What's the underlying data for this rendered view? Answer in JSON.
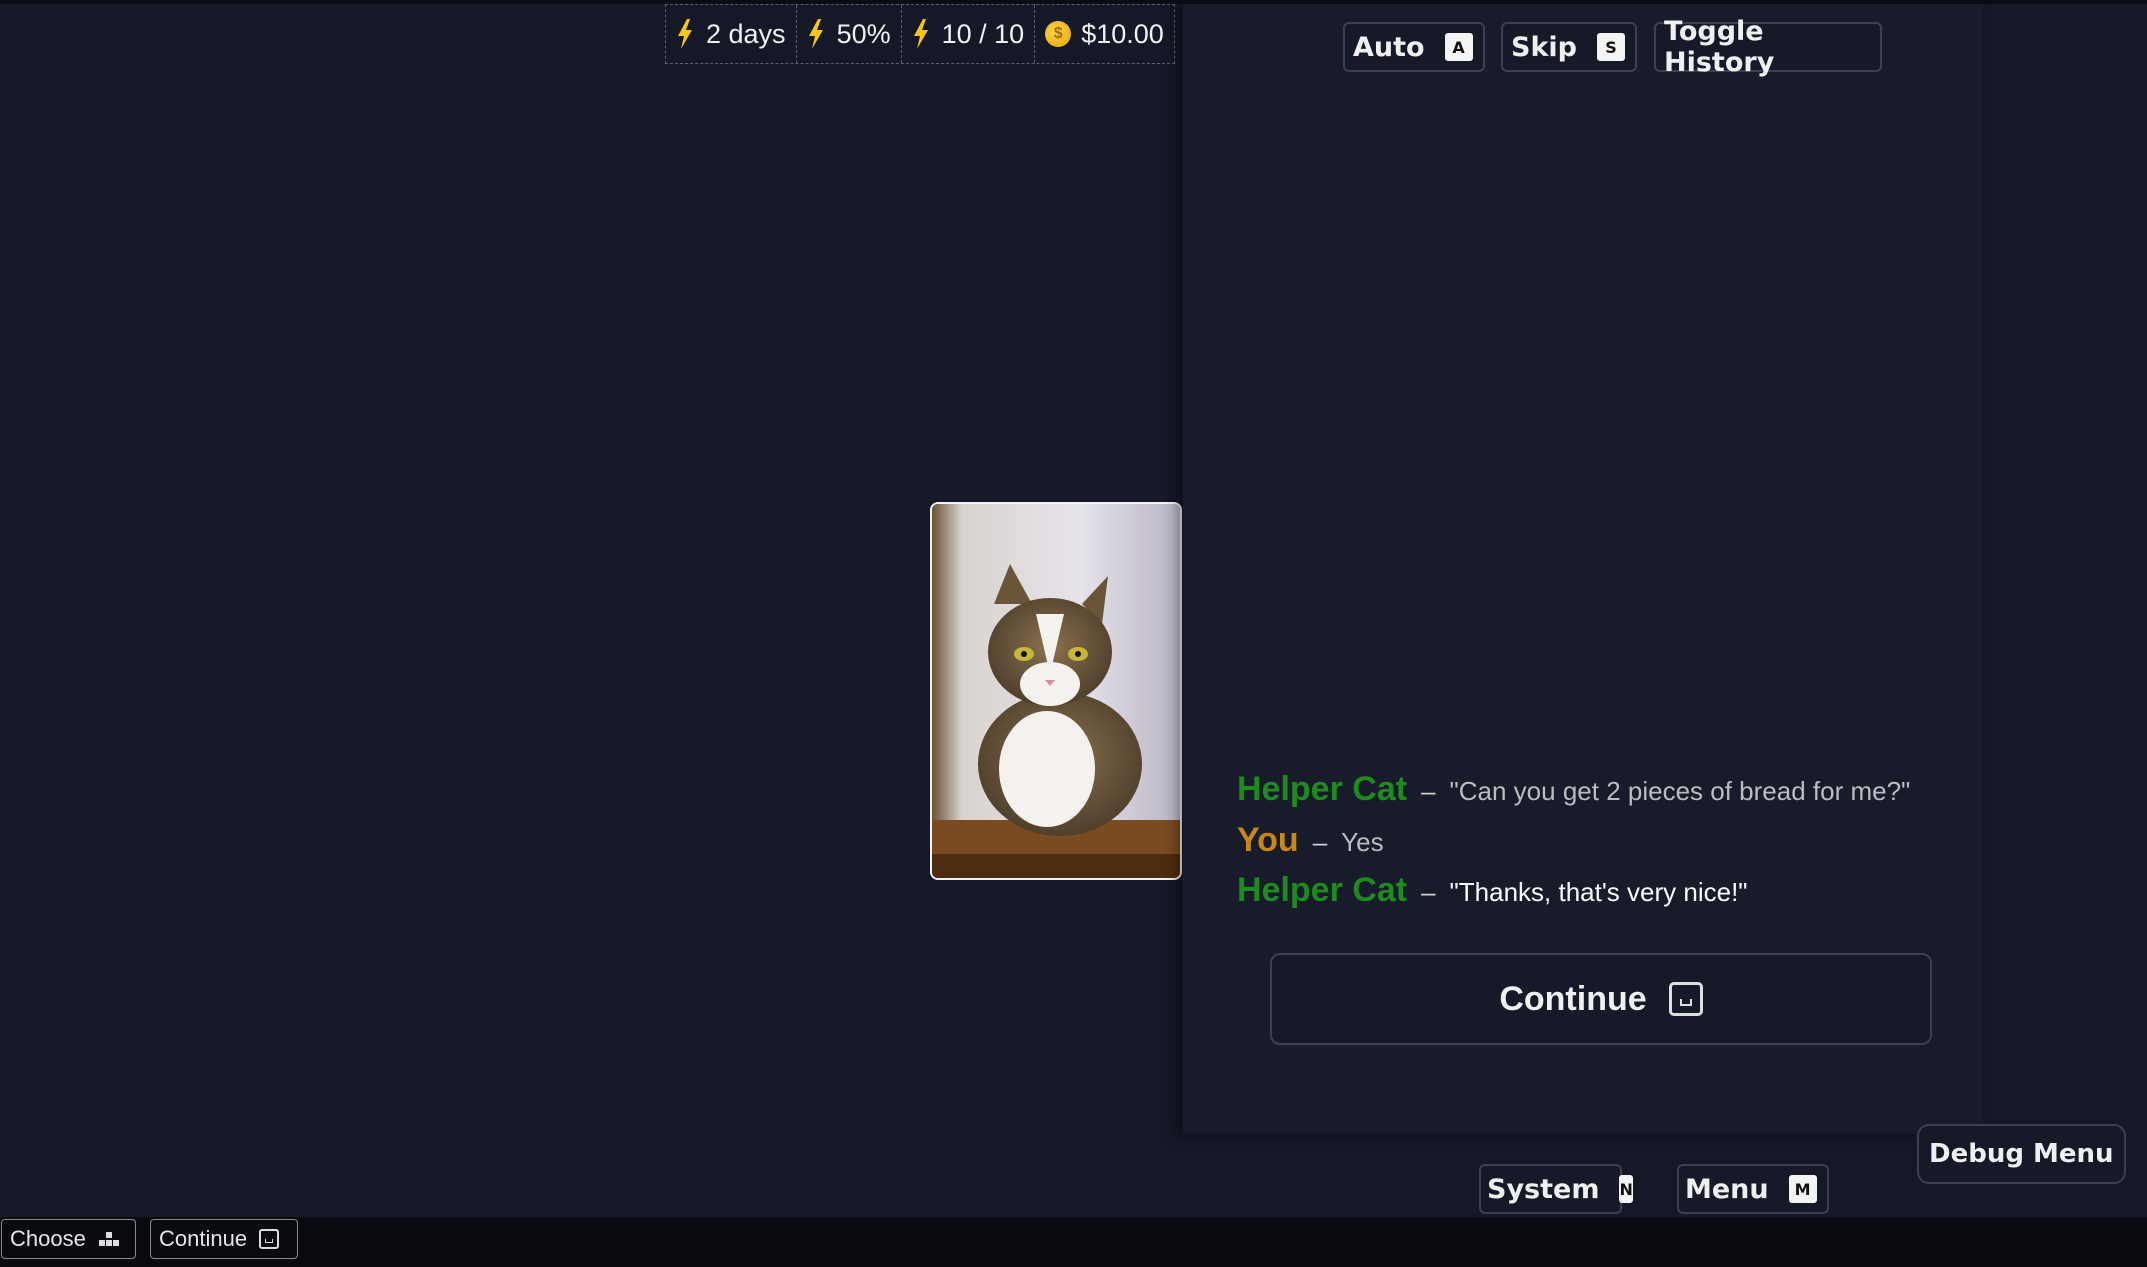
{
  "stats": {
    "days": "2 days",
    "percent": "50%",
    "energy": "10 / 10",
    "money": "$10.00",
    "bolt_color": "#f5c518",
    "coin_color": "#f0b400"
  },
  "controls": {
    "auto_label": "Auto",
    "auto_key": "A",
    "skip_label": "Skip",
    "skip_key": "S",
    "history_label": "Toggle History"
  },
  "dialogue": [
    {
      "speaker": "Helper Cat",
      "speaker_color": "#1f8a1f",
      "text": "\"Can you get 2 pieces of bread for me?\""
    },
    {
      "speaker": "You",
      "speaker_color": "#c9861a",
      "text": "Yes"
    },
    {
      "speaker": "Helper Cat",
      "speaker_color": "#1f8a1f",
      "text": "\"Thanks, that's very nice!\""
    }
  ],
  "continue_button": {
    "label": "Continue"
  },
  "bottom_menu": {
    "system_label": "System",
    "system_key": "N",
    "menu_label": "Menu",
    "menu_key": "M",
    "debug_label": "Debug Menu"
  },
  "hints": {
    "choose_label": "Choose",
    "continue_label": "Continue"
  },
  "character_icon": "cat-portrait"
}
